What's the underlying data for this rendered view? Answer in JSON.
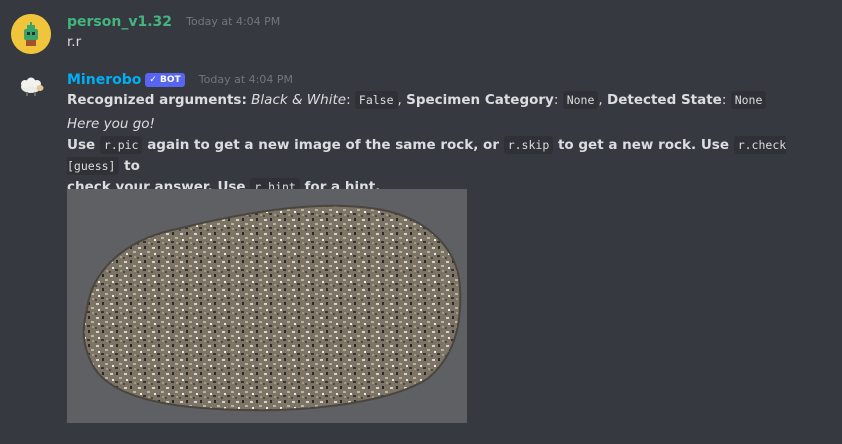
{
  "messages": [
    {
      "author": "person_v1.32",
      "timestamp": "Today at 4:04 PM",
      "text": "r.r",
      "author_color": "#43b581"
    },
    {
      "author": "Minerobo",
      "author_color": "#00aff4",
      "bot_tag": "✓ BOT",
      "timestamp": "Today at 4:04 PM",
      "args": {
        "label": "Recognized arguments:",
        "bw_label": "Black & White",
        "bw_value": "False",
        "category_label": "Specimen Category",
        "category_value": "None",
        "state_label": "Detected State",
        "state_value": "None"
      },
      "greeting": "Here you go!",
      "instructions": {
        "use1": "Use",
        "cmd_pic": "r.pic",
        "text1": "again to get a new image of the same rock, or",
        "cmd_skip": "r.skip",
        "text2": "to get a new rock. Use",
        "cmd_check": "r.check [guess]",
        "text3": "to",
        "text4": "check your answer. Use",
        "cmd_hint": "r.hint",
        "text5": "for a hint."
      },
      "attachment": {
        "alt": "rock specimen photo",
        "background": "#5f6063"
      }
    }
  ],
  "colors": {
    "background": "#36393f",
    "bot_tag": "#5865f2",
    "code_bg": "#2f3136"
  }
}
